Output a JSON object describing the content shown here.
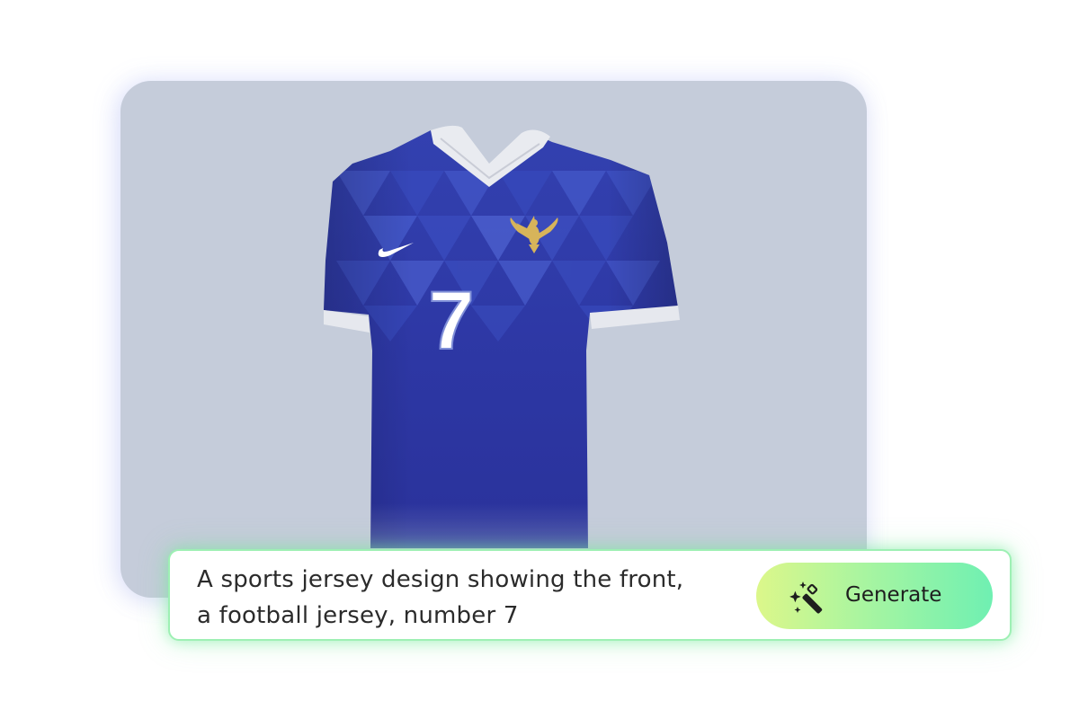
{
  "prompt": {
    "text": "A sports jersey design showing the front,\na football jersey,  number 7"
  },
  "generate_button": {
    "label": "Generate",
    "icon": "magic-wand-sparkles-icon"
  },
  "preview": {
    "jersey_number": "7",
    "crest_icon": "golden-eagle-crest-icon",
    "brand_icon": "swoosh-logo-icon"
  },
  "colors": {
    "card_background": "#c5ccda",
    "jersey_blue": "#2f3aa8",
    "bar_border": "#9ef0b4",
    "button_gradient_start": "#dcf78a",
    "button_gradient_end": "#6ff0b2"
  }
}
